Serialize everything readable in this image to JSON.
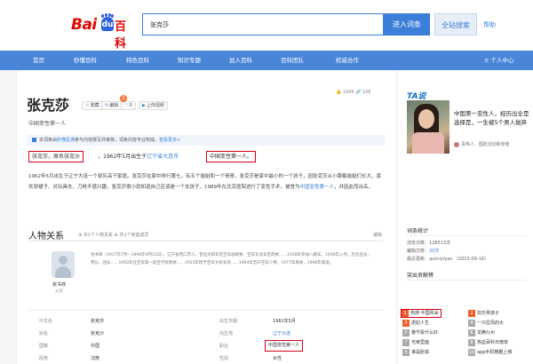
{
  "logo": {
    "bai": "Bai",
    "du": "du",
    "bk": "百科"
  },
  "search": {
    "value": "张克莎",
    "enter_label": "进入词条",
    "all_label": "全站搜索",
    "help_label": "帮助"
  },
  "nav": {
    "items": [
      "首页",
      "秒懂百科",
      "特色百科",
      "知识专题",
      "加入百科",
      "百科团队",
      "权威合作"
    ],
    "user_center": "≡ 个人中心"
  },
  "entry": {
    "title": "张克莎",
    "subtitle": "中国变性第一人",
    "actions": [
      "收藏",
      "编辑",
      "0",
      "上传视频"
    ],
    "badge": "2",
    "stats": "👍 1006   🔗 108",
    "notice_text": "本词条由",
    "notice_link": "秒懂星课",
    "notice_rest": "参与内容撰写并审核，词条内容专业权威。",
    "notice_more": "查看更多>",
    "alias_box": "张克莎，原名张克沙",
    "birth_text": "，1962年5月出生于",
    "birth_link1": "辽宁省",
    "birth_link2": "大连市",
    "fame_box": "中国变性第一人。",
    "paragraph_1": "1962年5月出生于辽宁大连一个部队高干家庭。张克莎在家中排行第七，有五个姐姐和一个哥哥，张克莎是家中最小的一个孩子，因张克莎从小跟着姐姐们长大，喜欢穿裙子、对玩具车、刀枪不感兴趣，张克莎很小就知道自己应该是一个女孩子，1989年在北京医院进行了变性手术，被誉为",
    "paragraph_link": "中国变性第一人",
    "paragraph_2": "，并因此而出名。"
  },
  "relations": {
    "title": "人物关系",
    "subtitle": "⊕ 共1个人物关系    ⊕ 共1个家庭成员",
    "edit": "编辑",
    "person_name": "张书祥",
    "person_role": "父亲",
    "person_desc": "张书祥（1917年7月—1998年9月21日），辽宁省营口市人，曾任沈阳军区空军副政委、空军东北军区政委……1938年参加八路军，1939年入党，历任连长、营长、团长……1950年任空军第一航空学校政委……1955年授予空军大校军衔……1964年晋升空军少将，1977年离休，1998年病逝。"
  },
  "info": [
    {
      "label": "中文名",
      "value": "张克莎"
    },
    {
      "label": "出生日期",
      "value": "1962年5月"
    },
    {
      "label": "别名",
      "value": "张克沙"
    },
    {
      "label": "出生地",
      "value": "辽宁大连"
    },
    {
      "label": "国籍",
      "value": "中国"
    },
    {
      "label": "职业",
      "value": "中国变性第一人"
    },
    {
      "label": "民族",
      "value": "汉族"
    },
    {
      "label": "性别",
      "value": "女性"
    }
  ],
  "sidebar": {
    "brand": "TA说",
    "brand_cn": "TA说",
    "article_title": "中国第一变性人，经历出全是选择是，一生被5个男人抛弃",
    "author": "青陶人 · 国防活动新使者",
    "stats_title": "词条统计",
    "stats": [
      {
        "label": "浏览次数：",
        "value": "128513次"
      },
      {
        "label": "编辑次数：",
        "value": "20次"
      },
      {
        "label": "最近更新：",
        "value": "qutniyiyan （2023-09-16）"
      }
    ],
    "hot_title": "突出贡献榜",
    "ranks": [
      {
        "num": "1",
        "text": "热搜·中国风采",
        "hot": true
      },
      {
        "num": "2",
        "text": "欢乐男孩子",
        "hot": true
      },
      {
        "num": "3",
        "text": "虐妃人生",
        "hot": true
      },
      {
        "num": "4",
        "text": "一只拉风的大",
        "hot": false
      },
      {
        "num": "5",
        "text": "春节看什么好",
        "hot": false
      },
      {
        "num": "6",
        "text": "龙腾九州",
        "hot": false
      },
      {
        "num": "7",
        "text": "光荣里面",
        "hot": false
      },
      {
        "num": "8",
        "text": "热血百科日榜单",
        "hot": false
      },
      {
        "num": "9",
        "text": "谁是卧底",
        "hot": false
      },
      {
        "num": "10",
        "text": "app手机榜趣上榜",
        "hot": false
      }
    ]
  }
}
